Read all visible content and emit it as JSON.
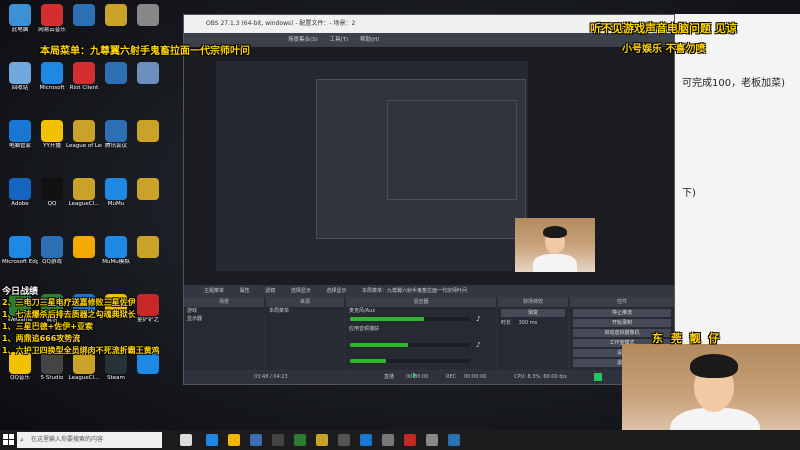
{
  "overlay": {
    "top_right_1": "听不见游戏声音电脑问题 见谅",
    "top_right_2": "小号娱乐    不喜勿喷",
    "menu_title": "本局菜单：九尊翼六射手鬼畜拉面一代宗师叶问",
    "bottom_right": "东  莞  靓  仔",
    "battle_title": "今日战绩",
    "battle_lines": [
      "2、三电刀三星电疗送嘉修败三星佐伊",
      "1、七法爆杀后排去质器之勾魂典狱长",
      "1、三星巴德+佐伊+亚索",
      "1、两鼎追666攻势流",
      "1、六护卫四换型全员绑肉不死流折霸王黄鸡"
    ]
  },
  "desktop": {
    "icons": [
      {
        "label": "此电脑",
        "color": "#3d8fd6"
      },
      {
        "label": "网易云音乐",
        "color": "#d32f2f"
      },
      {
        "label": "",
        "color": "#2c6fb5"
      },
      {
        "label": "",
        "color": "#c9a227"
      },
      {
        "label": "",
        "color": "#888888"
      },
      {
        "label": "回收站",
        "color": "#6fa8dc"
      },
      {
        "label": "Microsoft",
        "color": "#1e88e5"
      },
      {
        "label": "Riot Client",
        "color": "#d32f2f"
      },
      {
        "label": "",
        "color": "#2c6fb5"
      },
      {
        "label": "",
        "color": "#6c8ebf"
      },
      {
        "label": "电脑管家",
        "color": "#1976d2"
      },
      {
        "label": "YY开播",
        "color": "#f2c200"
      },
      {
        "label": "League of Legends",
        "color": "#c9a227"
      },
      {
        "label": "腾讯会议",
        "color": "#2c6fb5"
      },
      {
        "label": "",
        "color": "#c9a227"
      },
      {
        "label": "Adobe",
        "color": "#1565c0"
      },
      {
        "label": "QQ",
        "color": "#111111"
      },
      {
        "label": "LeagueCl...",
        "color": "#c9a227"
      },
      {
        "label": "MuMu",
        "color": "#1e88e5"
      },
      {
        "label": "",
        "color": "#c9a227"
      },
      {
        "label": "Microsoft Edge",
        "color": "#1e88e5"
      },
      {
        "label": "QQ游戏",
        "color": "#2c6fb5"
      },
      {
        "label": "",
        "color": "#f2a900"
      },
      {
        "label": "MuMu模拟",
        "color": "#1e88e5"
      },
      {
        "label": "",
        "color": "#c9a227"
      },
      {
        "label": "WeGame",
        "color": "#2e7d32"
      },
      {
        "label": "微信",
        "color": "#2e7d32"
      },
      {
        "label": "",
        "color": "#1976d2"
      },
      {
        "label": "",
        "color": "#f2c200"
      },
      {
        "label": "金铲铲之",
        "color": "#c62828"
      },
      {
        "label": "QQ音乐",
        "color": "#f2c200"
      },
      {
        "label": "5 Studio",
        "color": "#444444"
      },
      {
        "label": "LeagueCl...",
        "color": "#c9a227"
      },
      {
        "label": "Steam",
        "color": "#263238"
      },
      {
        "label": "",
        "color": "#1e88e5"
      }
    ]
  },
  "obs": {
    "title": "OBS 27.1.3 (64-bit, windows) - 配置文件：- 场景：2",
    "menu": [
      "场景集合(S)",
      "工具(T)",
      "帮助(H)"
    ],
    "toolbar": [
      "主题菜单",
      "属性",
      "滤镜",
      "选择显示",
      "选择显示",
      "本局菜单：九尊翼六射手鬼畜拉面一代宗师叶问"
    ],
    "dock_headers": [
      "场景",
      "来源",
      "混音器",
      "转场特效",
      "控件"
    ],
    "scenes": [
      "游戏",
      "显示器"
    ],
    "sources": [
      "本局菜单"
    ],
    "mixer": [
      {
        "label": "麦克风/Aux",
        "level": 0.62,
        "color": "#2eb82e"
      },
      {
        "label": "应用音频捕获",
        "level": 0.48,
        "color": "#2eb82e"
      },
      {
        "label": "",
        "level": 0.3,
        "color": "#2eb82e"
      }
    ],
    "transition": {
      "name": "渐变",
      "duration_label": "时长",
      "duration": "300 ms"
    },
    "controls": [
      "停止推流",
      "开始录制",
      "启动虚拟摄像机",
      "工作室模式",
      "设置",
      "退出"
    ],
    "status": {
      "live": "直播",
      "live_time": "00:00:00",
      "rec": "REC",
      "rec_time": "00:00:00",
      "cpu": "CPU: 8.3%, 60.00 fps"
    }
  },
  "player": {
    "time": "03:48 / 04:23"
  },
  "background_doc": {
    "line1": "可完成100，老板加菜)",
    "line2": "下)"
  },
  "taskbar": {
    "search_placeholder": "在这里输入你要搜索的内容"
  }
}
